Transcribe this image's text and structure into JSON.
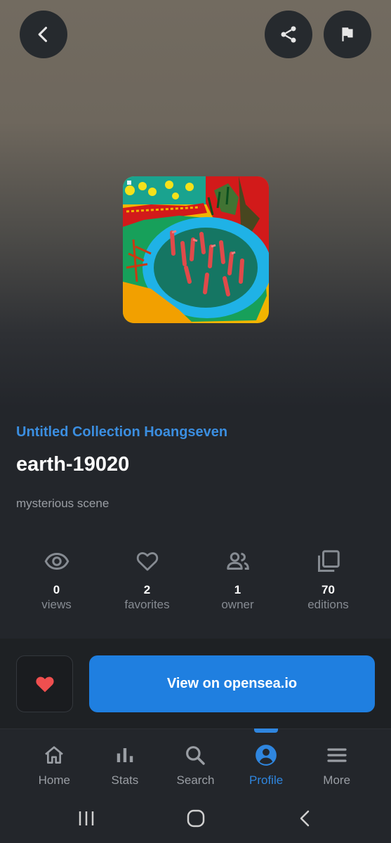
{
  "header": {
    "back_icon": "chevron-left-icon",
    "share_icon": "share-icon",
    "flag_icon": "flag-icon"
  },
  "nft": {
    "collection": "Untitled Collection Hoangseven",
    "title": "earth-19020",
    "description": "mysterious scene"
  },
  "stats": [
    {
      "icon": "eye-icon",
      "value": "0",
      "label": "views"
    },
    {
      "icon": "heart-outline-icon",
      "value": "2",
      "label": "favorites"
    },
    {
      "icon": "people-icon",
      "value": "1",
      "label": "owner"
    },
    {
      "icon": "layers-icon",
      "value": "70",
      "label": "editions"
    }
  ],
  "actions": {
    "like_icon": "heart-filled-icon",
    "view_button_label": "View on opensea.io"
  },
  "bottom_nav": {
    "active": "Profile",
    "items": [
      {
        "icon": "home-icon",
        "label": "Home"
      },
      {
        "icon": "bar-chart-icon",
        "label": "Stats"
      },
      {
        "icon": "search-icon",
        "label": "Search"
      },
      {
        "icon": "account-circle-icon",
        "label": "Profile"
      },
      {
        "icon": "menu-icon",
        "label": "More"
      }
    ]
  },
  "colors": {
    "accent": "#2f86df",
    "collection_link": "#3b8ee0",
    "button_primary": "#1f7fe0",
    "like_heart": "#ef4f4f",
    "background": "#23262b"
  }
}
